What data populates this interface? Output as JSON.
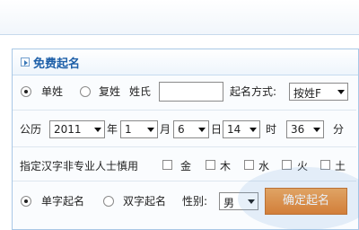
{
  "panel": {
    "title": "免费起名"
  },
  "row1": {
    "opt_single": "单姓",
    "opt_compound": "复姓",
    "surname_label": "姓氏",
    "surname_value": "",
    "method_label": "起名方式:",
    "method_value": "按姓F"
  },
  "row2": {
    "calendar_label": "公历",
    "year": "2011",
    "year_unit": "年",
    "month": "1",
    "month_unit": "月",
    "day": "6",
    "day_unit": "日",
    "hour": "14",
    "hour_unit": "时",
    "minute": "36",
    "minute_unit": "分"
  },
  "row3": {
    "label": "指定汉字非专业人士慎用",
    "elements": [
      "金",
      "木",
      "水",
      "火",
      "土"
    ]
  },
  "row4": {
    "opt_single_char": "单字起名",
    "opt_double_char": "双字起名",
    "gender_label": "性别:",
    "gender_value": "男",
    "confirm_label": "确定起名"
  }
}
